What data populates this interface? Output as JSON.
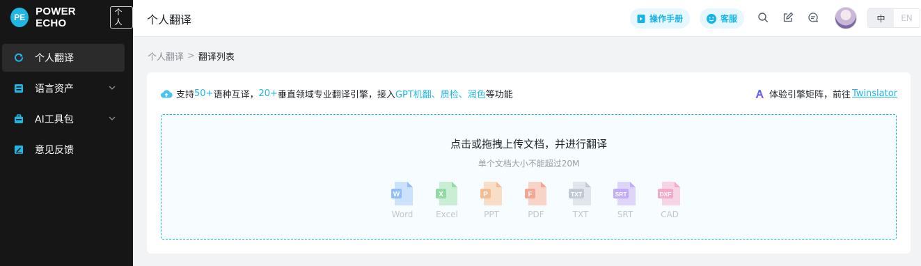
{
  "brand": {
    "logo_text": "PE",
    "name": "POWER ECHO",
    "tag": "个人"
  },
  "sidebar": {
    "items": [
      {
        "label": "个人翻译",
        "icon": "refresh-icon",
        "active": true
      },
      {
        "label": "语言资产",
        "icon": "database-icon",
        "expandable": true
      },
      {
        "label": "AI工具包",
        "icon": "toolbox-icon",
        "expandable": true
      },
      {
        "label": "意见反馈",
        "icon": "edit-note-icon"
      }
    ]
  },
  "header": {
    "title": "个人翻译",
    "manual_label": "操作手册",
    "service_label": "客服",
    "lang_zh": "中",
    "lang_en": "EN"
  },
  "breadcrumb": {
    "root": "个人翻译",
    "separator": ">",
    "current": "翻译列表"
  },
  "info": {
    "t1": "支持",
    "h1": "50+",
    "t2": "语种互译，",
    "h2": "20+",
    "t3": "垂直领域专业翻译引擎，接入",
    "h3": "GPT机翻、质检、润色",
    "t4": "等功能",
    "engine_text": "体验引擎矩阵，前往",
    "engine_link": "Twinslator"
  },
  "upload": {
    "title": "点击或拖拽上传文档，并进行翻译",
    "subtitle": "单个文档大小不能超过20M",
    "formats": [
      {
        "label": "Word",
        "letter": "W",
        "color": "#3d8ef0",
        "light": "#a8ccfa"
      },
      {
        "label": "Excel",
        "letter": "X",
        "color": "#3fbf5a",
        "light": "#a6e3b2"
      },
      {
        "label": "PPT",
        "letter": "P",
        "color": "#f58a3a",
        "light": "#fbc69a"
      },
      {
        "label": "PDF",
        "letter": "F",
        "color": "#f0623a",
        "light": "#f8b29c"
      },
      {
        "label": "TXT",
        "letter": "TXT",
        "color": "#9aa3b2",
        "light": "#d0d5de"
      },
      {
        "label": "SRT",
        "letter": "SRT",
        "color": "#9a6cf0",
        "light": "#cdb6f8"
      },
      {
        "label": "CAD",
        "letter": "DXF",
        "color": "#f06aa0",
        "light": "#f8b6d0"
      }
    ]
  }
}
